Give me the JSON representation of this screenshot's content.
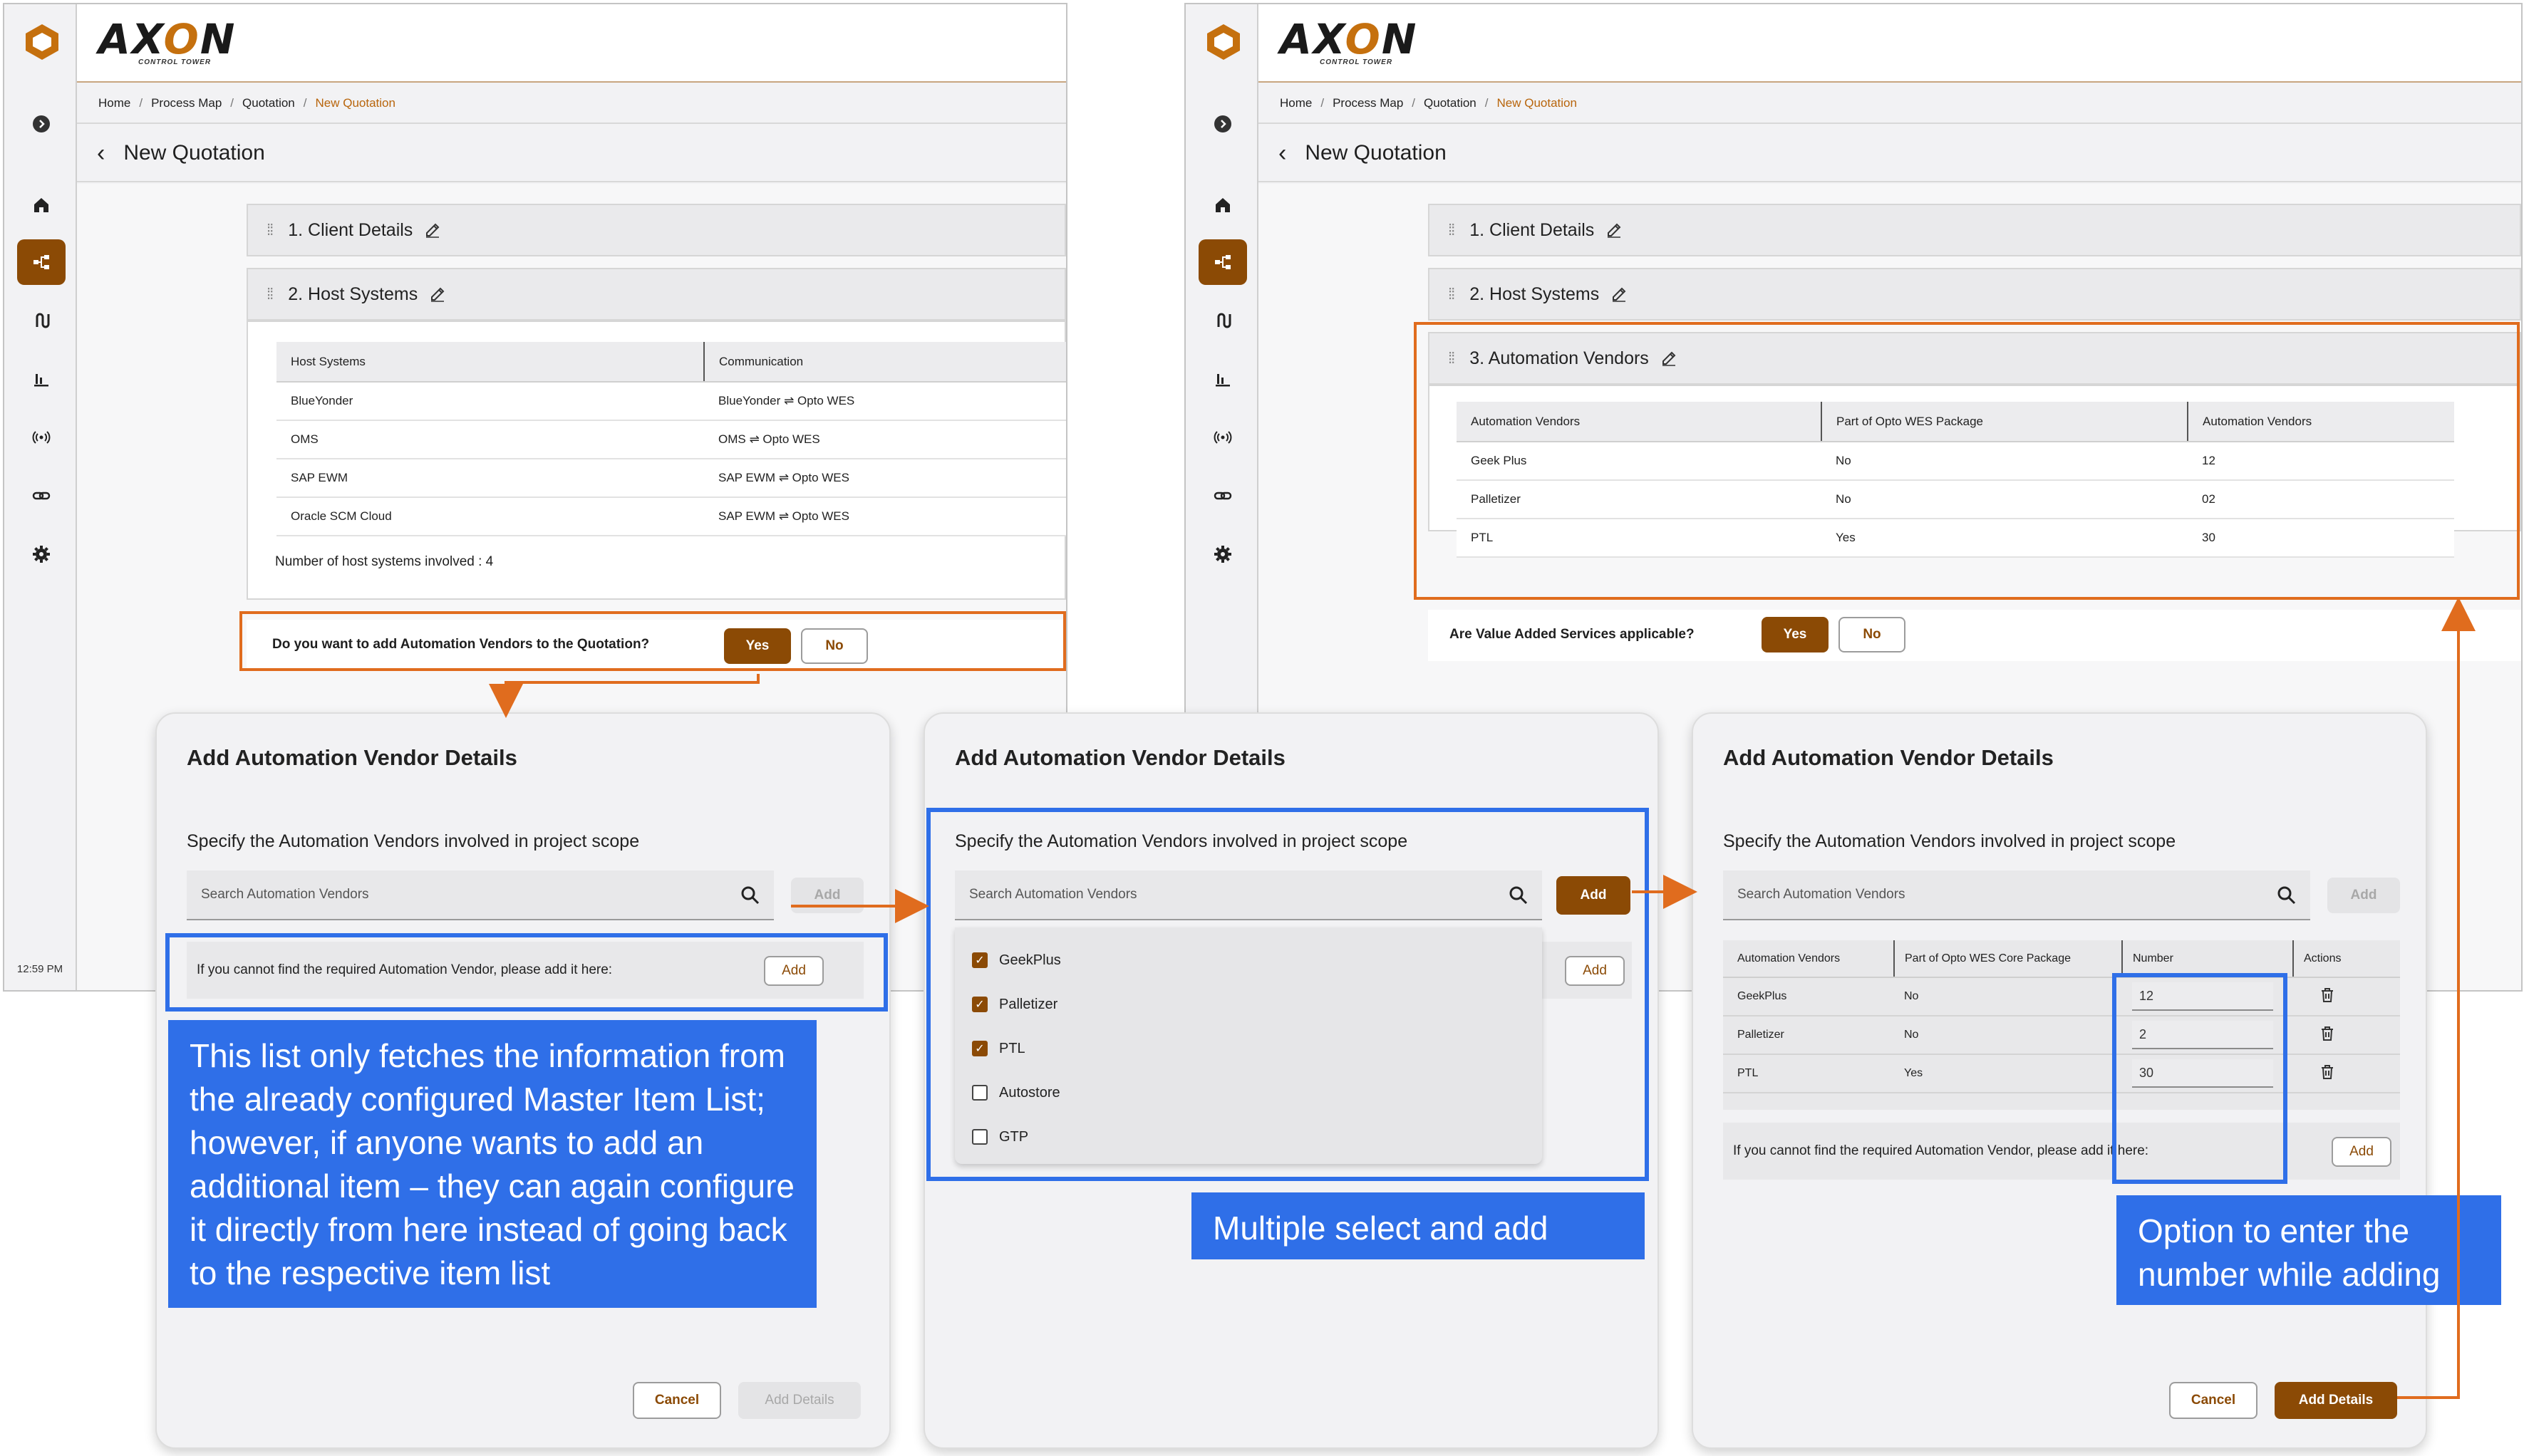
{
  "app": {
    "brand": "AXON",
    "brand_sub": "CONTROL TOWER",
    "time": "12:59 PM",
    "breadcrumb": [
      "Home",
      "Process Map",
      "Quotation",
      "New Quotation"
    ],
    "page_title": "New Quotation",
    "sidebar_icons": [
      "collapse-icon",
      "home-icon",
      "process-map-icon",
      "routes-icon",
      "chart-icon",
      "signal-icon",
      "link-icon",
      "gear-icon"
    ]
  },
  "left_screen": {
    "sections": [
      "1. Client Details",
      "2. Host Systems"
    ],
    "host_table": {
      "headers": [
        "Host Systems",
        "Communication"
      ],
      "rows": [
        [
          "BlueYonder",
          "BlueYonder ⇌ Opto WES"
        ],
        [
          "OMS",
          "OMS ⇌ Opto WES"
        ],
        [
          "SAP EWM",
          "SAP EWM ⇌ Opto WES"
        ],
        [
          "Oracle SCM Cloud",
          "SAP EWM ⇌ Opto WES"
        ]
      ]
    },
    "host_count": "Number of host systems involved : 4",
    "question": "Do you want to add Automation Vendors to the Quotation?",
    "yes": "Yes",
    "no": "No"
  },
  "right_screen": {
    "sections": [
      "1. Client Details",
      "2. Host Systems",
      "3. Automation Vendors"
    ],
    "vendor_table": {
      "headers": [
        "Automation Vendors",
        "Part of Opto WES Package",
        "Automation Vendors"
      ],
      "rows": [
        [
          "Geek Plus",
          "No",
          "12"
        ],
        [
          "Palletizer",
          "No",
          "02"
        ],
        [
          "PTL",
          "Yes",
          "30"
        ]
      ]
    },
    "question": "Are Value Added Services applicable?",
    "yes": "Yes",
    "no": "No"
  },
  "dialog_common": {
    "title": "Add Automation Vendor Details",
    "subtitle": "Specify the Automation Vendors involved in project scope",
    "search_placeholder": "Search Automation Vendors",
    "add": "Add",
    "cannot_find": "If you cannot find the required Automation Vendor, please add it here:",
    "cannot_find_short": "If you cannot find the required Automation Vendor, please add it here:",
    "cancel": "Cancel",
    "add_details": "Add Details"
  },
  "dialog2_options": [
    {
      "label": "GeekPlus",
      "checked": true
    },
    {
      "label": "Palletizer",
      "checked": true
    },
    {
      "label": "PTL",
      "checked": true
    },
    {
      "label": "Autostore",
      "checked": false
    },
    {
      "label": "GTP",
      "checked": false
    }
  ],
  "dialog3_table": {
    "headers": [
      "Automation Vendors",
      "Part of Opto WES Core Package",
      "Number",
      "Actions"
    ],
    "rows": [
      [
        "GeekPlus",
        "No",
        "12"
      ],
      [
        "Palletizer",
        "No",
        "2"
      ],
      [
        "PTL",
        "Yes",
        "30"
      ]
    ]
  },
  "callouts": {
    "master_list": "This list only fetches the information from the already configured Master Item List; however, if anyone wants to add an additional item – they can again configure it directly from here instead of going back to the respective item list",
    "multi_select": "Multiple select and add",
    "enter_number": "Option to enter the number while adding"
  },
  "colors": {
    "brand": "#8b4a05",
    "accent_orange": "#e06c1e",
    "annotation_blue": "#2f6fe8"
  }
}
